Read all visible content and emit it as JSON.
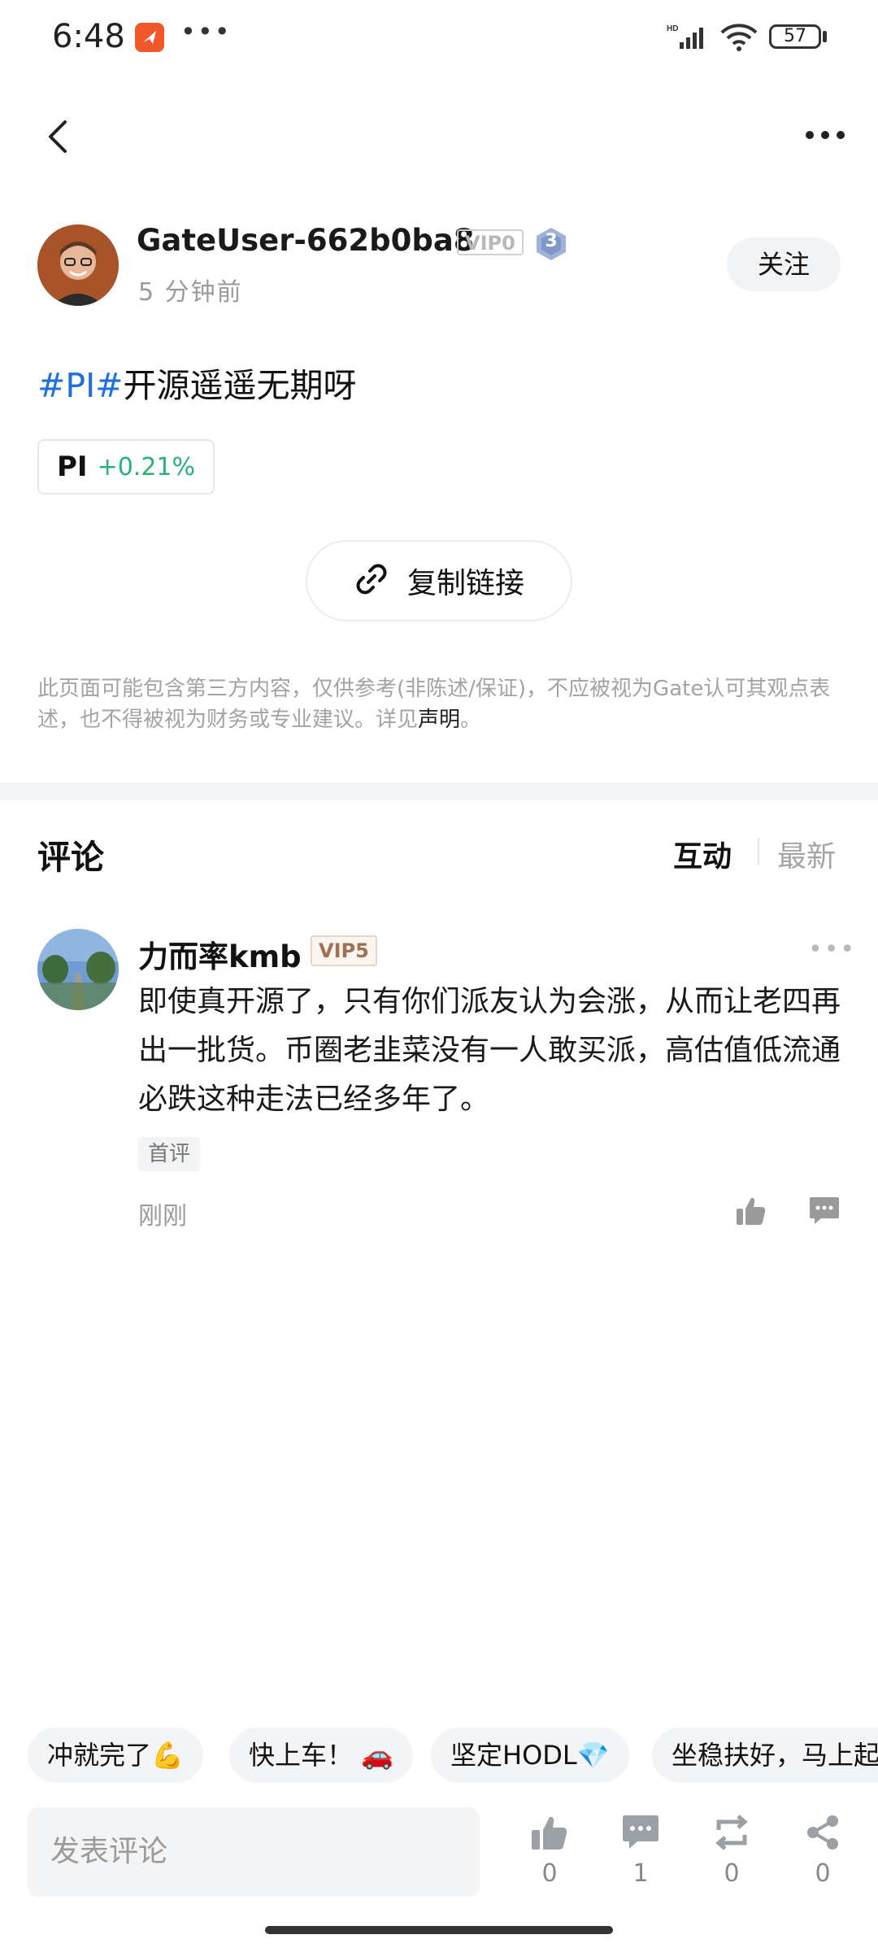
{
  "status": {
    "time": "6:48",
    "battery": "57"
  },
  "author": {
    "name": "GateUser-662b0ba8",
    "vip": "VIP0",
    "level": "3",
    "time_ago": "5 分钟前",
    "follow_label": "关注"
  },
  "post": {
    "tag": "#PI#",
    "text": "开源遥遥无期呀"
  },
  "coin": {
    "symbol": "PI",
    "change": "+0.21%",
    "change_color": "#27b27a"
  },
  "copy_link_label": "复制链接",
  "disclaimer": {
    "text": "此页面可能包含第三方内容，仅供参考(非陈述/保证)，不应被视为Gate认可其观点表述，也不得被视为财务或专业建议。详见",
    "link": "声明",
    "end": "。"
  },
  "comments": {
    "title": "评论",
    "sort_hot": "互动",
    "sort_new": "最新",
    "items": [
      {
        "user": "力而率kmb",
        "vip": "VIP5",
        "text": "即使真开源了，只有你们派友认为会涨，从而让老四再出一批货。币圈老韭菜没有一人敢买派，高估值低流通必跌这种走法已经多年了。",
        "badge": "首评",
        "time": "刚刚"
      }
    ]
  },
  "quick_replies": [
    "冲就完了💪",
    "快上车！ 🚗",
    "坚定HODL💎",
    "坐稳扶好，马上起飞"
  ],
  "composer": {
    "placeholder": "发表评论",
    "likes": "0",
    "comments": "1",
    "reposts": "0",
    "shares": "0"
  },
  "icons": [
    "back-icon",
    "more-icon",
    "link-icon",
    "like-icon",
    "reply-icon",
    "repost-icon",
    "share-icon"
  ],
  "colors": {
    "accent_blue": "#1f6fe0",
    "brand_orange": "#f0582a"
  }
}
